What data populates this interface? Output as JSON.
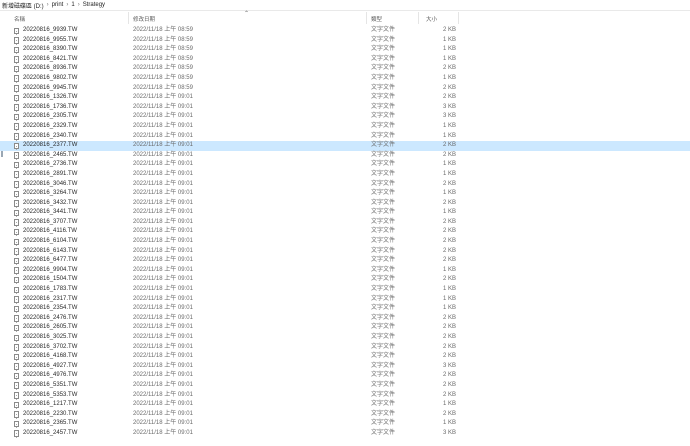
{
  "breadcrumb": {
    "items": [
      "新增磁碟區 (D:)",
      "print",
      "1",
      "Strategy"
    ],
    "separator": "›"
  },
  "columns": {
    "name": "名稱",
    "date": "修改日期",
    "type": "類型",
    "size": "大小"
  },
  "selected_index": 12,
  "files": [
    {
      "name": "20220816_9939.TW",
      "date": "2022/11/18 上午 08:59",
      "type": "文字文件",
      "size": "2 KB"
    },
    {
      "name": "20220816_9955.TW",
      "date": "2022/11/18 上午 08:59",
      "type": "文字文件",
      "size": "1 KB"
    },
    {
      "name": "20220816_8390.TW",
      "date": "2022/11/18 上午 08:59",
      "type": "文字文件",
      "size": "1 KB"
    },
    {
      "name": "20220816_8421.TW",
      "date": "2022/11/18 上午 08:59",
      "type": "文字文件",
      "size": "1 KB"
    },
    {
      "name": "20220816_8936.TW",
      "date": "2022/11/18 上午 08:59",
      "type": "文字文件",
      "size": "2 KB"
    },
    {
      "name": "20220816_9802.TW",
      "date": "2022/11/18 上午 08:59",
      "type": "文字文件",
      "size": "1 KB"
    },
    {
      "name": "20220816_9945.TW",
      "date": "2022/11/18 上午 08:59",
      "type": "文字文件",
      "size": "2 KB"
    },
    {
      "name": "20220816_1326.TW",
      "date": "2022/11/18 上午 09:01",
      "type": "文字文件",
      "size": "2 KB"
    },
    {
      "name": "20220816_1736.TW",
      "date": "2022/11/18 上午 09:01",
      "type": "文字文件",
      "size": "3 KB"
    },
    {
      "name": "20220816_2305.TW",
      "date": "2022/11/18 上午 09:01",
      "type": "文字文件",
      "size": "3 KB"
    },
    {
      "name": "20220816_2329.TW",
      "date": "2022/11/18 上午 09:01",
      "type": "文字文件",
      "size": "1 KB"
    },
    {
      "name": "20220816_2340.TW",
      "date": "2022/11/18 上午 09:01",
      "type": "文字文件",
      "size": "1 KB"
    },
    {
      "name": "20220816_2377.TW",
      "date": "2022/11/18 上午 09:01",
      "type": "文字文件",
      "size": "2 KB"
    },
    {
      "name": "20220816_2465.TW",
      "date": "2022/11/18 上午 09:01",
      "type": "文字文件",
      "size": "2 KB"
    },
    {
      "name": "20220816_2736.TW",
      "date": "2022/11/18 上午 09:01",
      "type": "文字文件",
      "size": "1 KB"
    },
    {
      "name": "20220816_2891.TW",
      "date": "2022/11/18 上午 09:01",
      "type": "文字文件",
      "size": "1 KB"
    },
    {
      "name": "20220816_3046.TW",
      "date": "2022/11/18 上午 09:01",
      "type": "文字文件",
      "size": "2 KB"
    },
    {
      "name": "20220816_3264.TW",
      "date": "2022/11/18 上午 09:01",
      "type": "文字文件",
      "size": "1 KB"
    },
    {
      "name": "20220816_3432.TW",
      "date": "2022/11/18 上午 09:01",
      "type": "文字文件",
      "size": "2 KB"
    },
    {
      "name": "20220816_3441.TW",
      "date": "2022/11/18 上午 09:01",
      "type": "文字文件",
      "size": "1 KB"
    },
    {
      "name": "20220816_3707.TW",
      "date": "2022/11/18 上午 09:01",
      "type": "文字文件",
      "size": "2 KB"
    },
    {
      "name": "20220816_4116.TW",
      "date": "2022/11/18 上午 09:01",
      "type": "文字文件",
      "size": "2 KB"
    },
    {
      "name": "20220816_6104.TW",
      "date": "2022/11/18 上午 09:01",
      "type": "文字文件",
      "size": "2 KB"
    },
    {
      "name": "20220816_6143.TW",
      "date": "2022/11/18 上午 09:01",
      "type": "文字文件",
      "size": "2 KB"
    },
    {
      "name": "20220816_6477.TW",
      "date": "2022/11/18 上午 09:01",
      "type": "文字文件",
      "size": "2 KB"
    },
    {
      "name": "20220816_9904.TW",
      "date": "2022/11/18 上午 09:01",
      "type": "文字文件",
      "size": "1 KB"
    },
    {
      "name": "20220816_1504.TW",
      "date": "2022/11/18 上午 09:01",
      "type": "文字文件",
      "size": "2 KB"
    },
    {
      "name": "20220816_1783.TW",
      "date": "2022/11/18 上午 09:01",
      "type": "文字文件",
      "size": "1 KB"
    },
    {
      "name": "20220816_2317.TW",
      "date": "2022/11/18 上午 09:01",
      "type": "文字文件",
      "size": "1 KB"
    },
    {
      "name": "20220816_2354.TW",
      "date": "2022/11/18 上午 09:01",
      "type": "文字文件",
      "size": "1 KB"
    },
    {
      "name": "20220816_2476.TW",
      "date": "2022/11/18 上午 09:01",
      "type": "文字文件",
      "size": "2 KB"
    },
    {
      "name": "20220816_2605.TW",
      "date": "2022/11/18 上午 09:01",
      "type": "文字文件",
      "size": "2 KB"
    },
    {
      "name": "20220816_3025.TW",
      "date": "2022/11/18 上午 09:01",
      "type": "文字文件",
      "size": "2 KB"
    },
    {
      "name": "20220816_3702.TW",
      "date": "2022/11/18 上午 09:01",
      "type": "文字文件",
      "size": "2 KB"
    },
    {
      "name": "20220816_4168.TW",
      "date": "2022/11/18 上午 09:01",
      "type": "文字文件",
      "size": "2 KB"
    },
    {
      "name": "20220816_4927.TW",
      "date": "2022/11/18 上午 09:01",
      "type": "文字文件",
      "size": "3 KB"
    },
    {
      "name": "20220816_4976.TW",
      "date": "2022/11/18 上午 09:01",
      "type": "文字文件",
      "size": "2 KB"
    },
    {
      "name": "20220816_5351.TW",
      "date": "2022/11/18 上午 09:01",
      "type": "文字文件",
      "size": "2 KB"
    },
    {
      "name": "20220816_5353.TW",
      "date": "2022/11/18 上午 09:01",
      "type": "文字文件",
      "size": "2 KB"
    },
    {
      "name": "20220816_1217.TW",
      "date": "2022/11/18 上午 09:01",
      "type": "文字文件",
      "size": "1 KB"
    },
    {
      "name": "20220816_2230.TW",
      "date": "2022/11/18 上午 09:01",
      "type": "文字文件",
      "size": "2 KB"
    },
    {
      "name": "20220816_2365.TW",
      "date": "2022/11/18 上午 09:01",
      "type": "文字文件",
      "size": "1 KB"
    },
    {
      "name": "20220816_2457.TW",
      "date": "2022/11/18 上午 09:01",
      "type": "文字文件",
      "size": "3 KB"
    }
  ]
}
